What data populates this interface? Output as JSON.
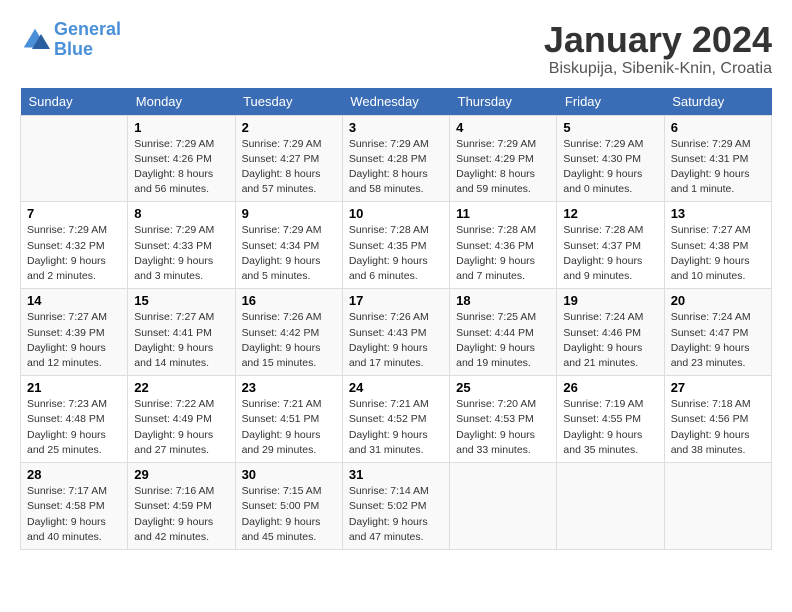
{
  "header": {
    "logo_line1": "General",
    "logo_line2": "Blue",
    "main_title": "January 2024",
    "subtitle": "Biskupija, Sibenik-Knin, Croatia"
  },
  "calendar": {
    "headers": [
      "Sunday",
      "Monday",
      "Tuesday",
      "Wednesday",
      "Thursday",
      "Friday",
      "Saturday"
    ],
    "weeks": [
      [
        {
          "day": "",
          "sunrise": "",
          "sunset": "",
          "daylight": ""
        },
        {
          "day": "1",
          "sunrise": "Sunrise: 7:29 AM",
          "sunset": "Sunset: 4:26 PM",
          "daylight": "Daylight: 8 hours and 56 minutes."
        },
        {
          "day": "2",
          "sunrise": "Sunrise: 7:29 AM",
          "sunset": "Sunset: 4:27 PM",
          "daylight": "Daylight: 8 hours and 57 minutes."
        },
        {
          "day": "3",
          "sunrise": "Sunrise: 7:29 AM",
          "sunset": "Sunset: 4:28 PM",
          "daylight": "Daylight: 8 hours and 58 minutes."
        },
        {
          "day": "4",
          "sunrise": "Sunrise: 7:29 AM",
          "sunset": "Sunset: 4:29 PM",
          "daylight": "Daylight: 8 hours and 59 minutes."
        },
        {
          "day": "5",
          "sunrise": "Sunrise: 7:29 AM",
          "sunset": "Sunset: 4:30 PM",
          "daylight": "Daylight: 9 hours and 0 minutes."
        },
        {
          "day": "6",
          "sunrise": "Sunrise: 7:29 AM",
          "sunset": "Sunset: 4:31 PM",
          "daylight": "Daylight: 9 hours and 1 minute."
        }
      ],
      [
        {
          "day": "7",
          "sunrise": "Sunrise: 7:29 AM",
          "sunset": "Sunset: 4:32 PM",
          "daylight": "Daylight: 9 hours and 2 minutes."
        },
        {
          "day": "8",
          "sunrise": "Sunrise: 7:29 AM",
          "sunset": "Sunset: 4:33 PM",
          "daylight": "Daylight: 9 hours and 3 minutes."
        },
        {
          "day": "9",
          "sunrise": "Sunrise: 7:29 AM",
          "sunset": "Sunset: 4:34 PM",
          "daylight": "Daylight: 9 hours and 5 minutes."
        },
        {
          "day": "10",
          "sunrise": "Sunrise: 7:28 AM",
          "sunset": "Sunset: 4:35 PM",
          "daylight": "Daylight: 9 hours and 6 minutes."
        },
        {
          "day": "11",
          "sunrise": "Sunrise: 7:28 AM",
          "sunset": "Sunset: 4:36 PM",
          "daylight": "Daylight: 9 hours and 7 minutes."
        },
        {
          "day": "12",
          "sunrise": "Sunrise: 7:28 AM",
          "sunset": "Sunset: 4:37 PM",
          "daylight": "Daylight: 9 hours and 9 minutes."
        },
        {
          "day": "13",
          "sunrise": "Sunrise: 7:27 AM",
          "sunset": "Sunset: 4:38 PM",
          "daylight": "Daylight: 9 hours and 10 minutes."
        }
      ],
      [
        {
          "day": "14",
          "sunrise": "Sunrise: 7:27 AM",
          "sunset": "Sunset: 4:39 PM",
          "daylight": "Daylight: 9 hours and 12 minutes."
        },
        {
          "day": "15",
          "sunrise": "Sunrise: 7:27 AM",
          "sunset": "Sunset: 4:41 PM",
          "daylight": "Daylight: 9 hours and 14 minutes."
        },
        {
          "day": "16",
          "sunrise": "Sunrise: 7:26 AM",
          "sunset": "Sunset: 4:42 PM",
          "daylight": "Daylight: 9 hours and 15 minutes."
        },
        {
          "day": "17",
          "sunrise": "Sunrise: 7:26 AM",
          "sunset": "Sunset: 4:43 PM",
          "daylight": "Daylight: 9 hours and 17 minutes."
        },
        {
          "day": "18",
          "sunrise": "Sunrise: 7:25 AM",
          "sunset": "Sunset: 4:44 PM",
          "daylight": "Daylight: 9 hours and 19 minutes."
        },
        {
          "day": "19",
          "sunrise": "Sunrise: 7:24 AM",
          "sunset": "Sunset: 4:46 PM",
          "daylight": "Daylight: 9 hours and 21 minutes."
        },
        {
          "day": "20",
          "sunrise": "Sunrise: 7:24 AM",
          "sunset": "Sunset: 4:47 PM",
          "daylight": "Daylight: 9 hours and 23 minutes."
        }
      ],
      [
        {
          "day": "21",
          "sunrise": "Sunrise: 7:23 AM",
          "sunset": "Sunset: 4:48 PM",
          "daylight": "Daylight: 9 hours and 25 minutes."
        },
        {
          "day": "22",
          "sunrise": "Sunrise: 7:22 AM",
          "sunset": "Sunset: 4:49 PM",
          "daylight": "Daylight: 9 hours and 27 minutes."
        },
        {
          "day": "23",
          "sunrise": "Sunrise: 7:21 AM",
          "sunset": "Sunset: 4:51 PM",
          "daylight": "Daylight: 9 hours and 29 minutes."
        },
        {
          "day": "24",
          "sunrise": "Sunrise: 7:21 AM",
          "sunset": "Sunset: 4:52 PM",
          "daylight": "Daylight: 9 hours and 31 minutes."
        },
        {
          "day": "25",
          "sunrise": "Sunrise: 7:20 AM",
          "sunset": "Sunset: 4:53 PM",
          "daylight": "Daylight: 9 hours and 33 minutes."
        },
        {
          "day": "26",
          "sunrise": "Sunrise: 7:19 AM",
          "sunset": "Sunset: 4:55 PM",
          "daylight": "Daylight: 9 hours and 35 minutes."
        },
        {
          "day": "27",
          "sunrise": "Sunrise: 7:18 AM",
          "sunset": "Sunset: 4:56 PM",
          "daylight": "Daylight: 9 hours and 38 minutes."
        }
      ],
      [
        {
          "day": "28",
          "sunrise": "Sunrise: 7:17 AM",
          "sunset": "Sunset: 4:58 PM",
          "daylight": "Daylight: 9 hours and 40 minutes."
        },
        {
          "day": "29",
          "sunrise": "Sunrise: 7:16 AM",
          "sunset": "Sunset: 4:59 PM",
          "daylight": "Daylight: 9 hours and 42 minutes."
        },
        {
          "day": "30",
          "sunrise": "Sunrise: 7:15 AM",
          "sunset": "Sunset: 5:00 PM",
          "daylight": "Daylight: 9 hours and 45 minutes."
        },
        {
          "day": "31",
          "sunrise": "Sunrise: 7:14 AM",
          "sunset": "Sunset: 5:02 PM",
          "daylight": "Daylight: 9 hours and 47 minutes."
        },
        {
          "day": "",
          "sunrise": "",
          "sunset": "",
          "daylight": ""
        },
        {
          "day": "",
          "sunrise": "",
          "sunset": "",
          "daylight": ""
        },
        {
          "day": "",
          "sunrise": "",
          "sunset": "",
          "daylight": ""
        }
      ]
    ]
  }
}
